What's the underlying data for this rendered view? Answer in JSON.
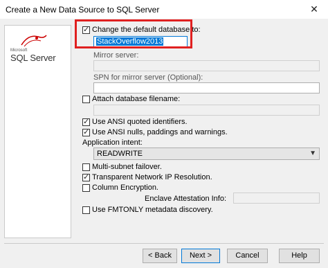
{
  "window": {
    "title": "Create a New Data Source to SQL Server",
    "close_glyph": "✕"
  },
  "logo": {
    "small": "Microsoft",
    "text": "SQL Server"
  },
  "options": {
    "change_db": {
      "label": "Change the default database to:",
      "checked": true,
      "value": "StackOverflow2013"
    },
    "mirror_server": {
      "label": "Mirror server:",
      "value": ""
    },
    "spn": {
      "label": "SPN for mirror server (Optional):",
      "value": ""
    },
    "attach_db": {
      "label": "Attach database filename:",
      "checked": false,
      "value": ""
    },
    "ansi_quoted": {
      "label": "Use ANSI quoted identifiers.",
      "checked": true
    },
    "ansi_nulls": {
      "label": "Use ANSI nulls, paddings and warnings.",
      "checked": true
    },
    "app_intent": {
      "label": "Application intent:",
      "value": "READWRITE"
    },
    "multi_subnet": {
      "label": "Multi-subnet failover.",
      "checked": false
    },
    "tnir": {
      "label": "Transparent Network IP Resolution.",
      "checked": true
    },
    "column_enc": {
      "label": "Column Encryption.",
      "checked": false
    },
    "enclave": {
      "label": "Enclave Attestation Info:",
      "value": ""
    },
    "fmtonly": {
      "label": "Use FMTONLY metadata discovery.",
      "checked": false
    }
  },
  "buttons": {
    "back": "< Back",
    "next": "Next >",
    "cancel": "Cancel",
    "help": "Help"
  },
  "colors": {
    "highlight_box": "#e02020",
    "selection": "#0078d7"
  }
}
